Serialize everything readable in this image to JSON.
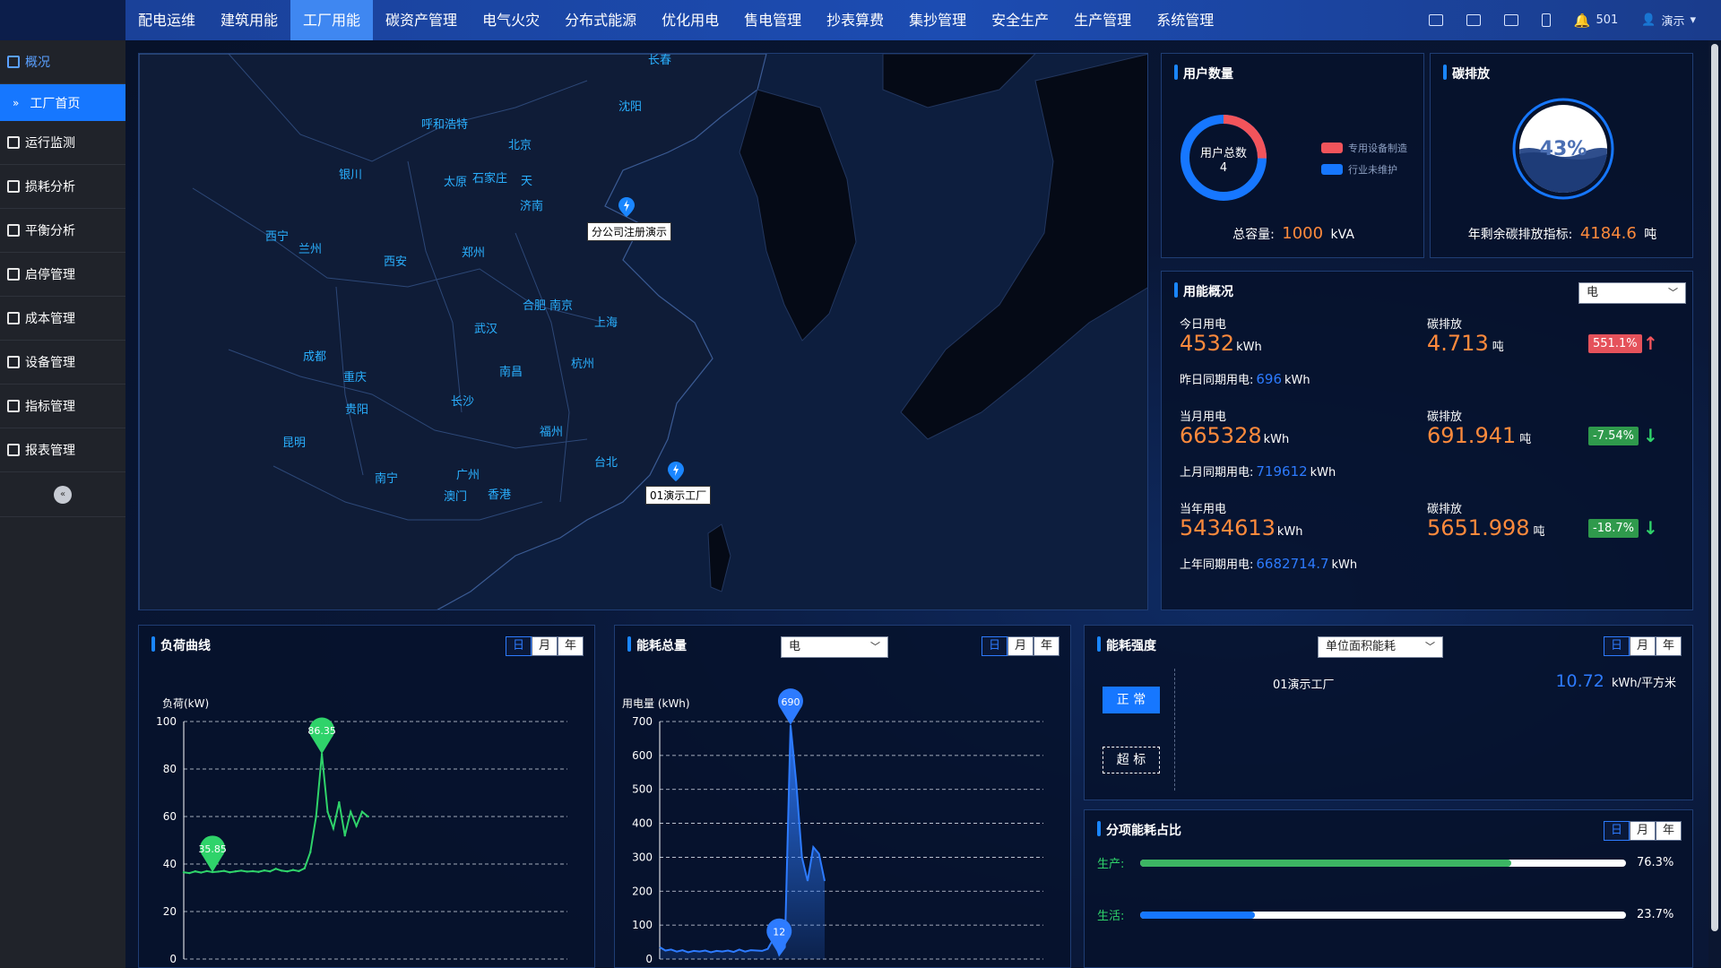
{
  "nav": {
    "items": [
      "配电运维",
      "建筑用能",
      "工厂用能",
      "碳资产管理",
      "电气火灾",
      "分布式能源",
      "优化用电",
      "售电管理",
      "抄表算费",
      "集抄管理",
      "安全生产",
      "生产管理",
      "系统管理"
    ],
    "active_index": 2,
    "notification_count": "501",
    "user_name": "演示"
  },
  "sidebar": {
    "items": [
      "概况",
      "运行监测",
      "损耗分析",
      "平衡分析",
      "启停管理",
      "成本管理",
      "设备管理",
      "指标管理",
      "报表管理"
    ],
    "sub_item": "工厂首页",
    "collapse_icon": "«"
  },
  "map": {
    "cities": [
      "长春",
      "沈阳",
      "呼和浩特",
      "北京",
      "天",
      "银川",
      "太原",
      "石家庄",
      "济南",
      "西宁",
      "兰州",
      "郑州",
      "西安",
      "合肥",
      "南京",
      "上海",
      "武汉",
      "成都",
      "重庆",
      "南昌",
      "杭州",
      "长沙",
      "贵阳",
      "福州",
      "昆明",
      "台北",
      "南宁",
      "广州",
      "澳门",
      "香港"
    ],
    "markers": [
      {
        "label": "分公司注册演示"
      },
      {
        "label": "01演示工厂"
      }
    ]
  },
  "users": {
    "title": "用户数量",
    "ring_label": "用户总数",
    "ring_value": "4",
    "legend": [
      {
        "name": "专用设备制造",
        "color": "#f2545b"
      },
      {
        "name": "行业未维护",
        "color": "#1677ff"
      }
    ],
    "capacity_label": "总容量:",
    "capacity_value": "1000",
    "capacity_unit": "kVA"
  },
  "carbon": {
    "title": "碳排放",
    "percent": "43%",
    "remaining_label": "年剩余碳排放指标:",
    "remaining_value": "4184.6",
    "remaining_unit": "吨"
  },
  "energy": {
    "title": "用能概况",
    "select": "电",
    "rows": [
      {
        "label": "今日用电",
        "value": "4532",
        "unit": "kWh",
        "cmp_label": "昨日同期用电:",
        "cmp_value": "696",
        "cmp_unit": "kWh",
        "c_label": "碳排放",
        "c_value": "4.713",
        "c_unit": "吨",
        "badge": "551.1%",
        "arrow": "↑",
        "trend": "up"
      },
      {
        "label": "当月用电",
        "value": "665328",
        "unit": "kWh",
        "cmp_label": "上月同期用电:",
        "cmp_value": "719612",
        "cmp_unit": "kWh",
        "c_label": "碳排放",
        "c_value": "691.941",
        "c_unit": "吨",
        "badge": "-7.54%",
        "arrow": "↓",
        "trend": "down"
      },
      {
        "label": "当年用电",
        "value": "5434613",
        "unit": "kWh",
        "cmp_label": "上年同期用电:",
        "cmp_value": "6682714.7",
        "cmp_unit": "kWh",
        "c_label": "碳排放",
        "c_value": "5651.998",
        "c_unit": "吨",
        "badge": "-18.7%",
        "arrow": "↓",
        "trend": "down"
      }
    ]
  },
  "load": {
    "title": "负荷曲线",
    "tabs": [
      "日",
      "月",
      "年"
    ],
    "ylabel": "负荷(kW)",
    "yticks": [
      "100",
      "80",
      "60",
      "40",
      "20",
      "0"
    ],
    "peak_labels": [
      "35.85",
      "86.35"
    ]
  },
  "total": {
    "title": "能耗总量",
    "select": "电",
    "tabs": [
      "日",
      "月",
      "年"
    ],
    "ylabel": "用电量 (kWh)",
    "yticks": [
      "700",
      "600",
      "500",
      "400",
      "300",
      "200",
      "100",
      "0"
    ],
    "peak_labels": [
      "690",
      "12"
    ]
  },
  "intensity": {
    "title": "能耗强度",
    "select": "单位面积能耗",
    "tabs": [
      "日",
      "月",
      "年"
    ],
    "btn_normal": "正 常",
    "btn_over": "超 标",
    "factory": "01演示工厂",
    "value": "10.72",
    "unit": "kWh/平方米"
  },
  "share": {
    "title": "分项能耗占比",
    "tabs": [
      "日",
      "月",
      "年"
    ],
    "rows": [
      {
        "label": "生产:",
        "value": "76.3%",
        "pct": 76.3,
        "color": "#3cb563"
      },
      {
        "label": "生活:",
        "value": "23.7%",
        "pct": 23.7,
        "color": "#1677ff"
      }
    ]
  },
  "chart_data": [
    {
      "type": "line",
      "ylabel": "负荷(kW)",
      "ylim": [
        0,
        100
      ],
      "series": [
        {
          "values": [
            36.5,
            36.2,
            36.9,
            36.4,
            37.0,
            36.6,
            36.8,
            37.1,
            36.5,
            36.9,
            37.2,
            36.8,
            37.0,
            36.7,
            37.3,
            36.9,
            38.0,
            37.2,
            36.9,
            37.5,
            37.0,
            38.2,
            45,
            60,
            86.35,
            62,
            55,
            66,
            52,
            62,
            56,
            62,
            60
          ]
        }
      ]
    },
    {
      "type": "area",
      "ylabel": "用电量 (kWh)",
      "ylim": [
        0,
        700
      ],
      "series": [
        {
          "values": [
            35,
            25,
            28,
            22,
            26,
            20,
            24,
            22,
            25,
            20,
            24,
            22,
            25,
            21,
            28,
            22,
            26,
            25,
            24,
            30,
            60,
            12,
            35,
            690,
            520,
            300,
            230,
            330,
            310,
            230
          ]
        }
      ]
    }
  ]
}
